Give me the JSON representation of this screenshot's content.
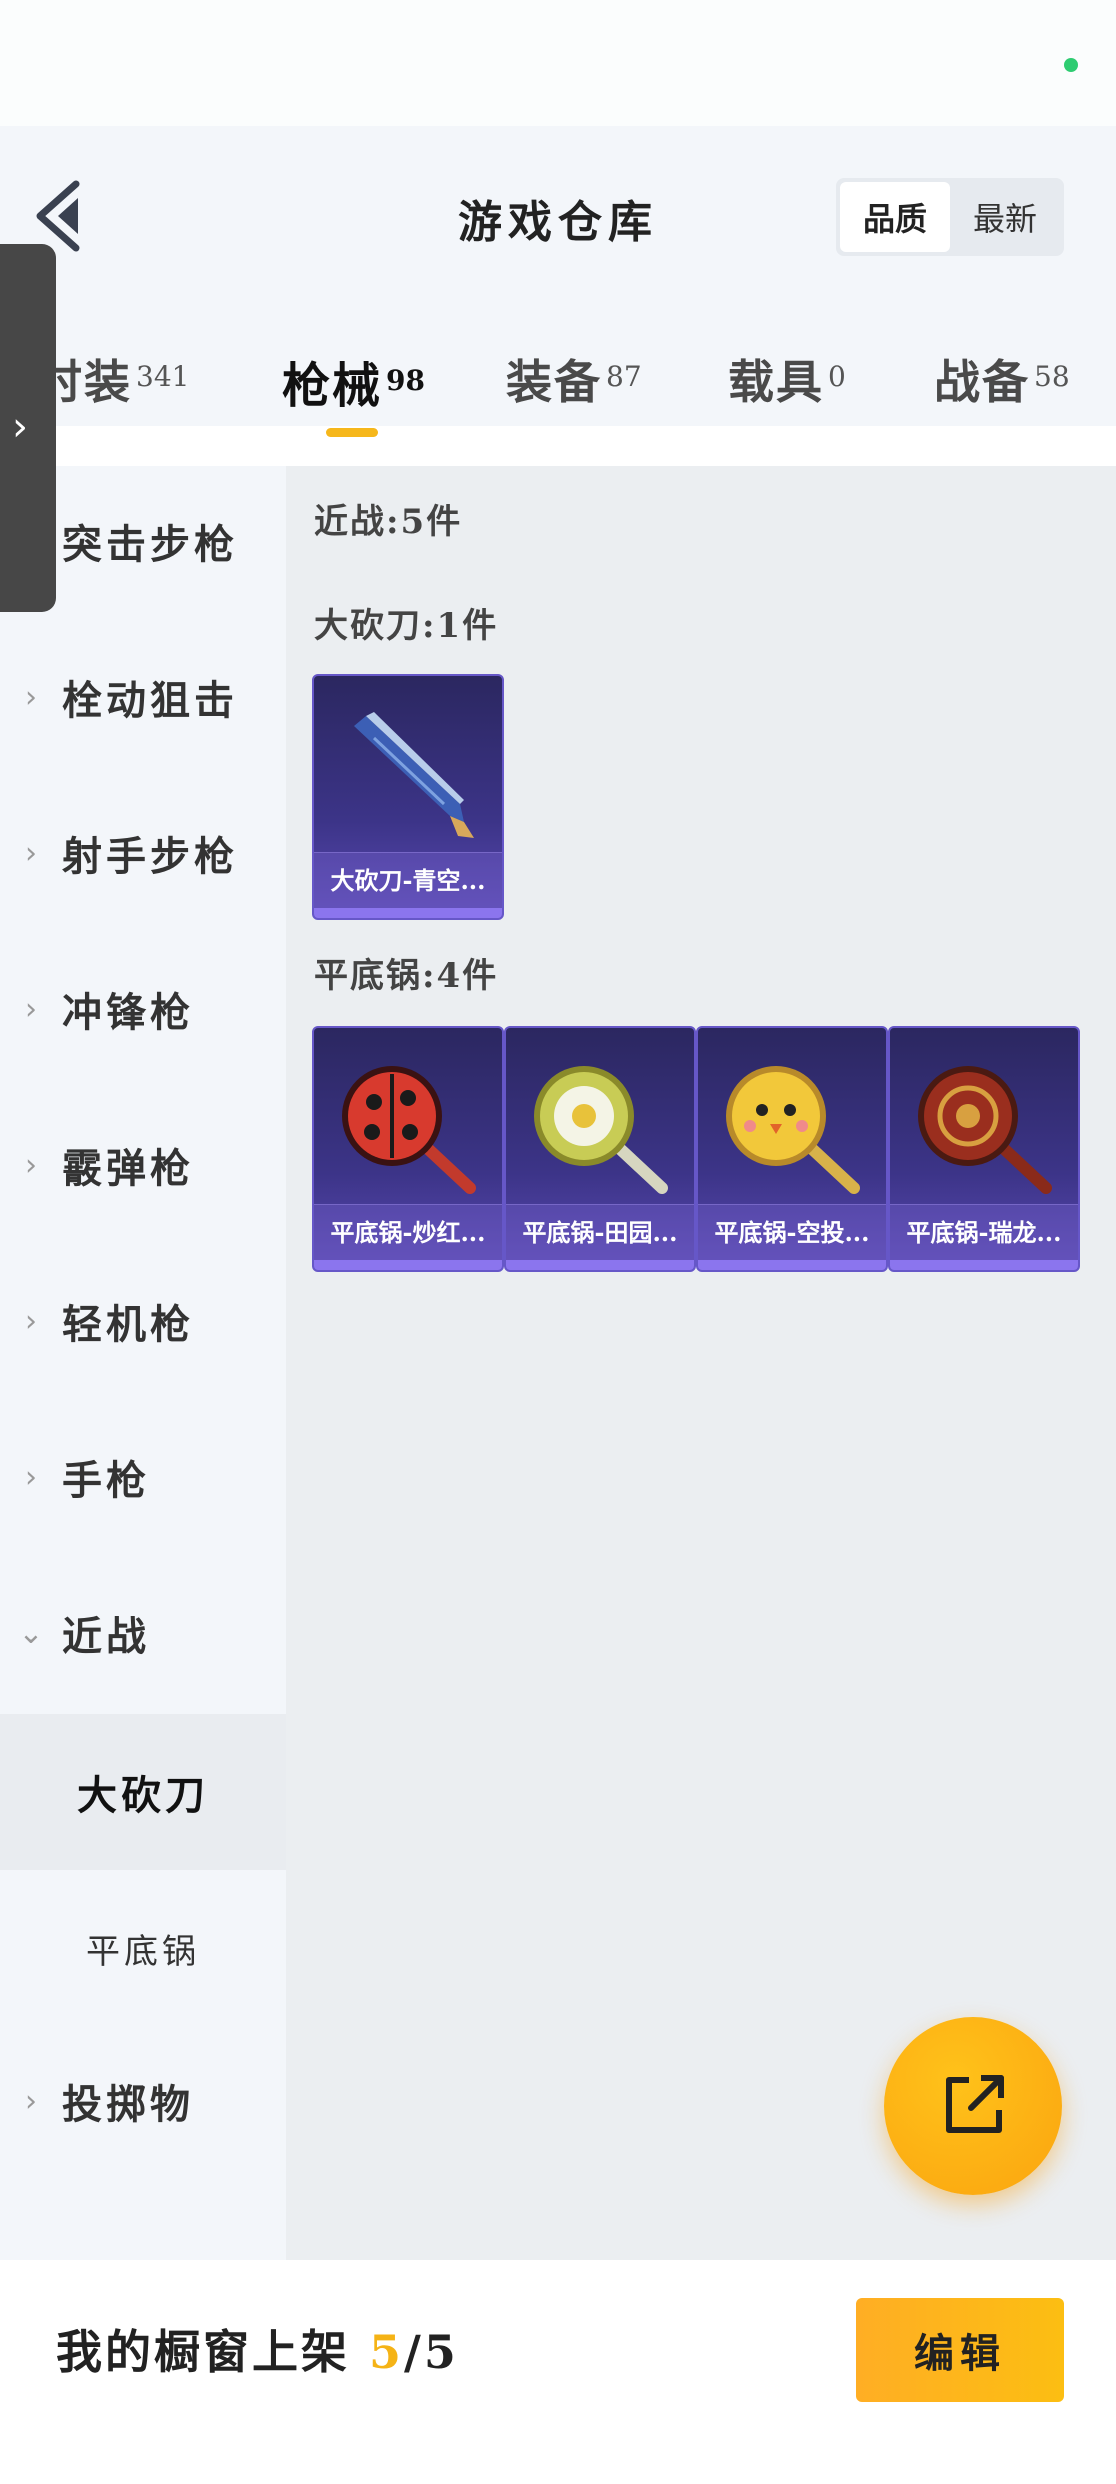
{
  "header": {
    "title": "游戏仓库",
    "sort_options": [
      {
        "label": "品质",
        "active": true
      },
      {
        "label": "最新",
        "active": false
      }
    ]
  },
  "tabs": [
    {
      "label": "时装",
      "count": "341",
      "active": false
    },
    {
      "label": "枪械",
      "count": "98",
      "active": true
    },
    {
      "label": "装备",
      "count": "87",
      "active": false
    },
    {
      "label": "载具",
      "count": "0",
      "active": false
    },
    {
      "label": "战备",
      "count": "58",
      "active": false
    }
  ],
  "sidebar": {
    "categories": [
      {
        "label": "突击步枪"
      },
      {
        "label": "栓动狙击"
      },
      {
        "label": "射手步枪"
      },
      {
        "label": "冲锋枪"
      },
      {
        "label": "霰弹枪"
      },
      {
        "label": "轻机枪"
      },
      {
        "label": "手枪"
      },
      {
        "label": "近战",
        "expanded": true
      },
      {
        "label": "投掷物"
      }
    ],
    "subcategories": [
      {
        "label": "大砍刀",
        "active": true
      },
      {
        "label": "平底锅",
        "active": false
      }
    ]
  },
  "content": {
    "group_title": "近战:5件",
    "sections": [
      {
        "title": "大砍刀:1件",
        "items": [
          {
            "name": "大砍刀-青空...",
            "icon": "machete-icon"
          }
        ]
      },
      {
        "title": "平底锅:4件",
        "items": [
          {
            "name": "平底锅-炒红...",
            "icon": "ladybug-pan-icon"
          },
          {
            "name": "平底锅-田园...",
            "icon": "daisy-pan-icon"
          },
          {
            "name": "平底锅-空投...",
            "icon": "chick-pan-icon"
          },
          {
            "name": "平底锅-瑞龙...",
            "icon": "dragon-pan-icon"
          }
        ]
      }
    ]
  },
  "fab": {
    "icon": "share-external-icon"
  },
  "bottom": {
    "label": "我的橱窗上架",
    "current": "5",
    "separator": "/",
    "total": "5",
    "edit_label": "编辑"
  },
  "colors": {
    "accent": "#f6b71b",
    "card_bg": "#3c3488",
    "sidebar_bg": "#f3f6fa",
    "content_bg": "#ebeef1"
  }
}
